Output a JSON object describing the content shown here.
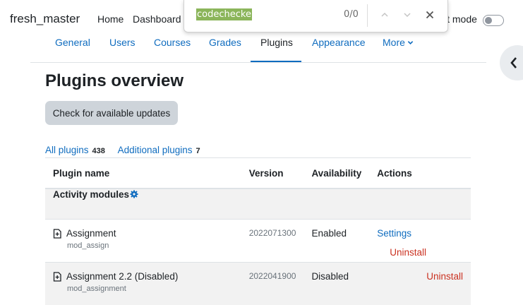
{
  "navbar": {
    "brand": "fresh_master",
    "links": [
      "Home",
      "Dashboard"
    ],
    "edit_mode_label": "it mode"
  },
  "findbar": {
    "query": "codechecke",
    "count": "0/0"
  },
  "secondary_nav": {
    "items": [
      "General",
      "Users",
      "Courses",
      "Grades",
      "Plugins",
      "Appearance",
      "More"
    ],
    "active": "Plugins"
  },
  "page": {
    "title": "Plugins overview",
    "check_updates_button": "Check for available updates"
  },
  "filters": {
    "all_label": "All plugins",
    "all_count": "438",
    "additional_label": "Additional plugins",
    "additional_count": "7"
  },
  "table": {
    "headers": [
      "Plugin name",
      "Version",
      "Availability",
      "Actions"
    ],
    "category": "Activity modules",
    "rows": [
      {
        "name": "Assignment",
        "component": "mod_assign",
        "version": "2022071300",
        "availability": "Enabled",
        "settings": "Settings",
        "uninstall": "Uninstall"
      },
      {
        "name": "Assignment 2.2 (Disabled)",
        "component": "mod_assignment",
        "version": "2022041900",
        "availability": "Disabled",
        "settings": "",
        "uninstall": "Uninstall"
      }
    ]
  },
  "colors": {
    "link": "#0f6cbf",
    "danger": "#ca3120",
    "find_highlight": "#8bb55a"
  }
}
